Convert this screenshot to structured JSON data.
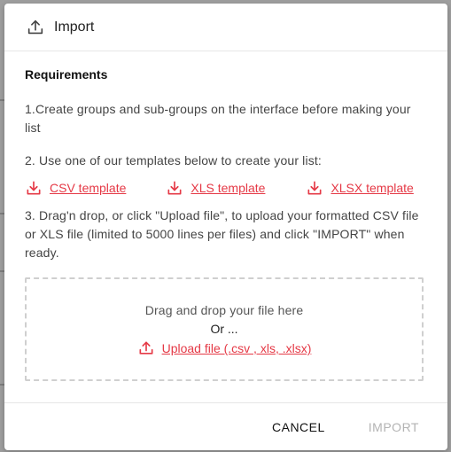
{
  "colors": {
    "accent": "#e53946",
    "disabled": "#b3b3b3"
  },
  "dialog": {
    "title": "Import",
    "title_icon": "upload-icon",
    "requirements_title": "Requirements",
    "step1": "1.Create groups and sub-groups on the interface before making your list",
    "step2": "2. Use one of our templates below to create your list:",
    "templates": [
      {
        "label": "CSV template",
        "icon": "download-icon"
      },
      {
        "label": "XLS template",
        "icon": "download-icon"
      },
      {
        "label": "XLSX template",
        "icon": "download-icon"
      }
    ],
    "step3": "3. Drag'n drop, or click \"Upload file\", to upload your formatted CSV file or XLS file (limited to 5000 lines per files) and click \"IMPORT\" when ready.",
    "dropzone": {
      "title": "Drag and drop your file here",
      "or": "Or ...",
      "upload_label": "Upload file (.csv , xls, .xlsx)",
      "upload_icon": "upload-icon"
    },
    "footer": {
      "cancel_label": "CANCEL",
      "import_label": "IMPORT"
    }
  }
}
